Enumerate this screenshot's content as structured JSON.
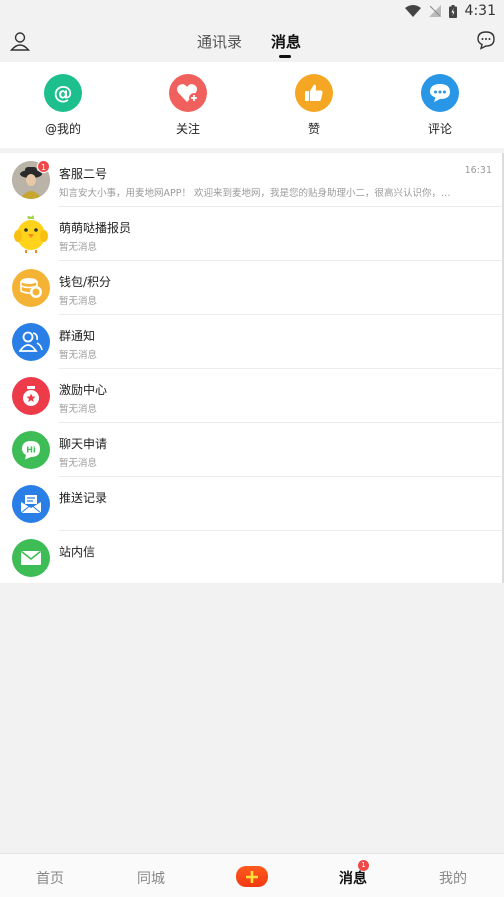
{
  "status_bar": {
    "time": "4:31"
  },
  "header": {
    "tabs": [
      {
        "label": "通讯录",
        "active": false
      },
      {
        "label": "消息",
        "active": true
      }
    ]
  },
  "quick_actions": [
    {
      "label": "@我的",
      "icon": "at-icon",
      "color": "#1dbf8c"
    },
    {
      "label": "关注",
      "icon": "heart-plus-icon",
      "color": "#f0615e"
    },
    {
      "label": "赞",
      "icon": "thumbs-up-icon",
      "color": "#f5a623"
    },
    {
      "label": "评论",
      "icon": "comment-icon",
      "color": "#2a97e6"
    }
  ],
  "messages": [
    {
      "title": "客服二号",
      "subtitle": "知言安大小事，用麦地网APP！ 欢迎来到麦地网，我是您的贴身助理小二，很高兴认识你，…",
      "time": "16:31",
      "badge": "1",
      "icon": "photo-avatar"
    },
    {
      "title": "萌萌哒播报员",
      "subtitle": "暂无消息",
      "time": "",
      "icon": "chick-icon"
    },
    {
      "title": "钱包/积分",
      "subtitle": "暂无消息",
      "time": "",
      "icon": "coins-icon",
      "color": "#f5a623"
    },
    {
      "title": "群通知",
      "subtitle": "暂无消息",
      "time": "",
      "icon": "group-icon",
      "color": "#2a7fe6"
    },
    {
      "title": "激励中心",
      "subtitle": "暂无消息",
      "time": "",
      "icon": "medal-icon",
      "color": "#ee3b4a"
    },
    {
      "title": "聊天申请",
      "subtitle": "暂无消息",
      "time": "",
      "icon": "hi-chat-icon",
      "color": "#3ebd56"
    },
    {
      "title": "推送记录",
      "subtitle": "",
      "time": "",
      "icon": "envelope-open-icon",
      "color": "#2a7fe6"
    },
    {
      "title": "站内信",
      "subtitle": "",
      "time": "",
      "icon": "envelope-icon",
      "color": "#3ebd56"
    }
  ],
  "bottom_nav": [
    {
      "label": "首页",
      "active": false
    },
    {
      "label": "同城",
      "active": false
    },
    {
      "label": "消息",
      "active": true,
      "badge": "1"
    },
    {
      "label": "我的",
      "active": false
    }
  ]
}
